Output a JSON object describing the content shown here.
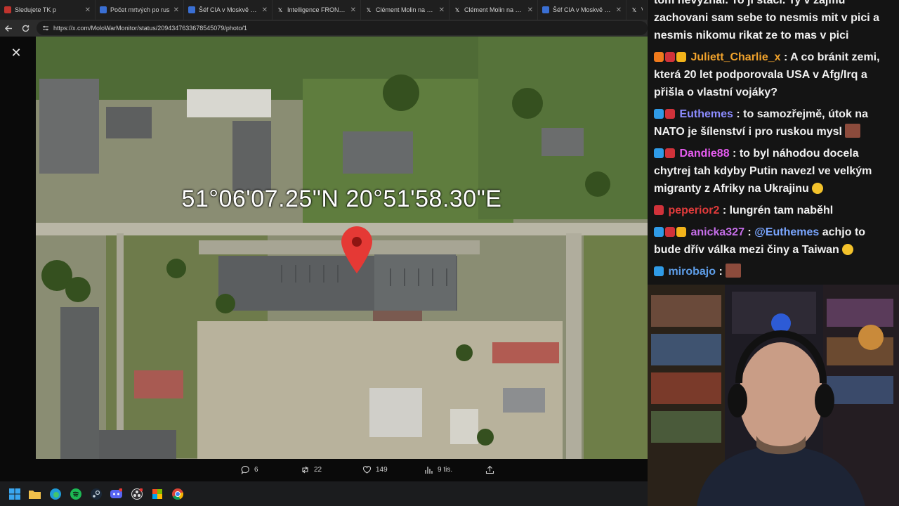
{
  "tabs": [
    {
      "title": "Sledujete TK p",
      "fav": "#c0342e"
    },
    {
      "title": "Počet mrtvých po rus",
      "fav": "#3a6fd3"
    },
    {
      "title": "Šéf CIA v Moskvě varov",
      "fav": "#3a6fd3"
    },
    {
      "title": "Intelligence FRONT na p",
      "fav": "x"
    },
    {
      "title": "Clément Molin na platfo",
      "fav": "x"
    },
    {
      "title": "Clément Molin na platfo",
      "fav": "x"
    },
    {
      "title": "Šéf CIA v Moskvě varov",
      "fav": "#3a6fd3"
    },
    {
      "title": "Visio",
      "fav": "x"
    }
  ],
  "url": "https://x.com/MoloWarMonitor/status/2094347633678545079/photo/1",
  "photo": {
    "coordinates": "51°06'07.25\"N 20°51'58.30\"E"
  },
  "actions": {
    "replies": "6",
    "reposts": "22",
    "likes": "149",
    "views": "9 tis."
  },
  "chat": [
    {
      "user": "",
      "color": "#ffffff",
      "badges": [],
      "text": "tom nevyznal. To ji staci. Ty v zajmu zachovani sam sebe to nesmis mit v pici a nesmis nikomu rikat ze to mas v pici"
    },
    {
      "user": "Juliett_Charlie_x",
      "color": "#f0a22c",
      "badges": [
        "orange",
        "red",
        "gold"
      ],
      "text": "A co bránit zemi, která 20 let podporovala USA v Afg/Irq a přišla o vlastní vojáky?"
    },
    {
      "user": "Euthemes",
      "color": "#8c8cff",
      "badges": [
        "blue",
        "red"
      ],
      "text": "to samozřejmě, útok na NATO je šílenství i pro ruskou mysl",
      "emote": true
    },
    {
      "user": "Dandie88",
      "color": "#e65cf0",
      "badges": [
        "blue",
        "red"
      ],
      "text": "to byl náhodou docela chytrej tah kdyby Putin navezl ve velkým migranty z Afriky na Ukrajinu",
      "smile": true
    },
    {
      "user": "peperior2",
      "color": "#e23b3b",
      "badges": [
        "red"
      ],
      "text": "lungrén tam naběhl"
    },
    {
      "user": "anicka327",
      "color": "#c56ee8",
      "badges": [
        "blue",
        "red",
        "gold"
      ],
      "mention": "@Euthemes",
      "text": "achjo to bude dřív válka mezi činy a Taiwan",
      "smile": true
    },
    {
      "user": "mirobajo",
      "color": "#5e9ee9",
      "badges": [
        "blue"
      ],
      "text": "",
      "emote": true
    }
  ]
}
